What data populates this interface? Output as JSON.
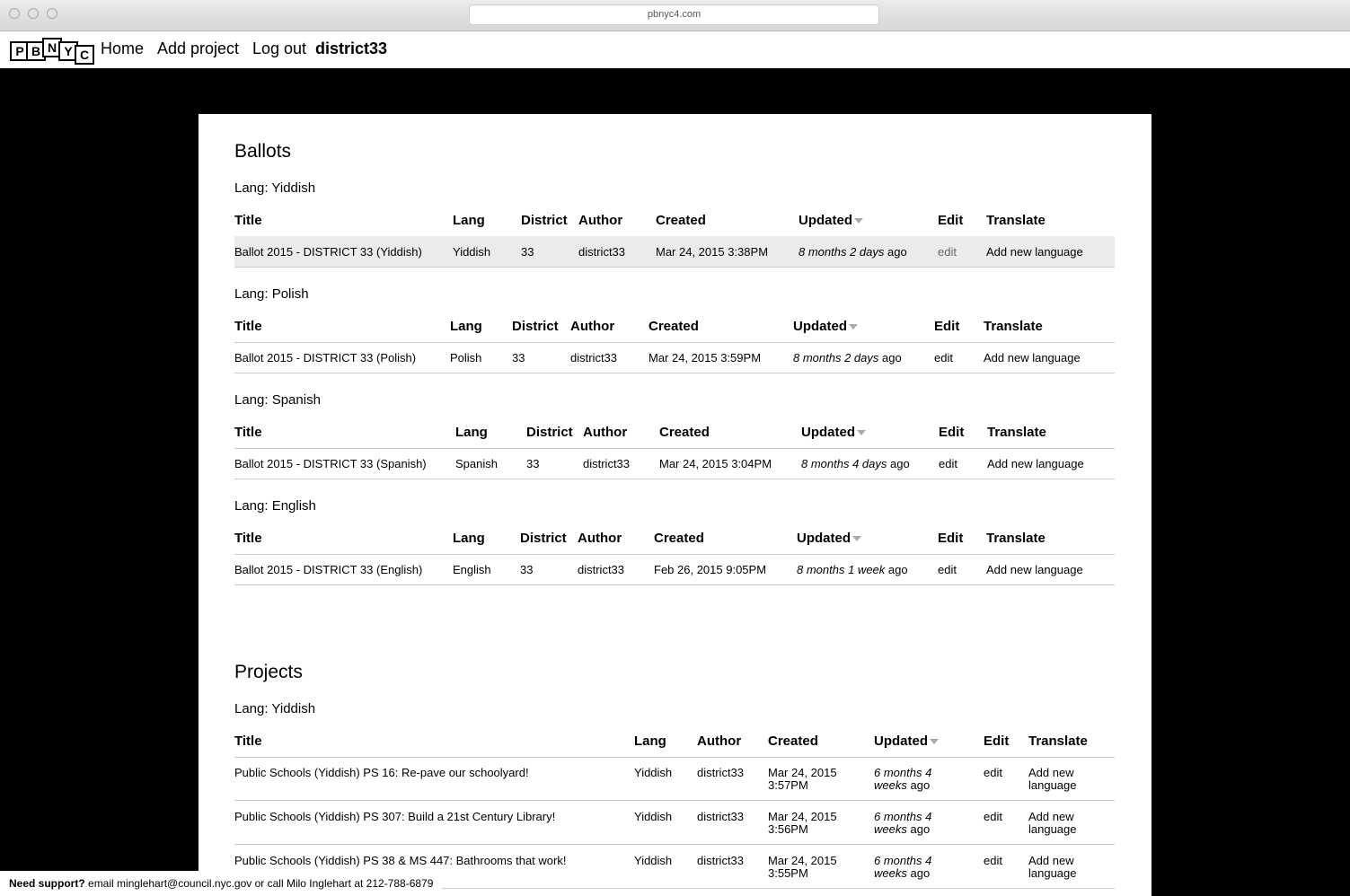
{
  "browser": {
    "url": "pbnyc4.com"
  },
  "nav": {
    "logo_letters": [
      "P",
      "B",
      "N",
      "Y",
      "C"
    ],
    "home": "Home",
    "add_project": "Add project",
    "logout": "Log out",
    "user": "district33"
  },
  "ballots": {
    "heading": "Ballots",
    "columns": {
      "title": "Title",
      "lang": "Lang",
      "district": "District",
      "author": "Author",
      "created": "Created",
      "updated": "Updated",
      "edit": "Edit",
      "translate": "Translate"
    },
    "groups": [
      {
        "lang_label": "Lang: Yiddish",
        "row": {
          "title": "Ballot 2015 - DISTRICT 33 (Yiddish)",
          "lang": "Yiddish",
          "district": "33",
          "author": "district33",
          "created": "Mar 24, 2015 3:38PM",
          "updated_italic": "8 months 2 days",
          "updated_suffix": "ago",
          "edit": "edit",
          "translate": "Add new language"
        }
      },
      {
        "lang_label": "Lang: Polish",
        "row": {
          "title": "Ballot 2015 - DISTRICT 33 (Polish)",
          "lang": "Polish",
          "district": "33",
          "author": "district33",
          "created": "Mar 24, 2015 3:59PM",
          "updated_italic": "8 months 2 days",
          "updated_suffix": "ago",
          "edit": "edit",
          "translate": "Add new language"
        }
      },
      {
        "lang_label": "Lang: Spanish",
        "row": {
          "title": "Ballot 2015 - DISTRICT 33 (Spanish)",
          "lang": "Spanish",
          "district": "33",
          "author": "district33",
          "created": "Mar 24, 2015 3:04PM",
          "updated_italic": "8 months 4 days",
          "updated_suffix": "ago",
          "edit": "edit",
          "translate": "Add new language"
        }
      },
      {
        "lang_label": "Lang: English",
        "row": {
          "title": "Ballot 2015 - DISTRICT 33 (English)",
          "lang": "English",
          "district": "33",
          "author": "district33",
          "created": "Feb 26, 2015 9:05PM",
          "updated_italic": "8 months 1 week",
          "updated_suffix": "ago",
          "edit": "edit",
          "translate": "Add new language"
        }
      }
    ]
  },
  "projects": {
    "heading": "Projects",
    "lang_label": "Lang: Yiddish",
    "columns": {
      "title": "Title",
      "lang": "Lang",
      "author": "Author",
      "created": "Created",
      "updated": "Updated",
      "edit": "Edit",
      "translate": "Translate"
    },
    "rows": [
      {
        "title": "Public Schools (Yiddish) PS 16: Re-pave our schoolyard!",
        "lang": "Yiddish",
        "author": "district33",
        "created_1": "Mar 24, 2015",
        "created_2": "3:57PM",
        "updated_1": "6 months 4",
        "updated_2_italic": "weeks",
        "updated_2_suffix": "ago",
        "edit": "edit",
        "translate_1": "Add new",
        "translate_2": "language"
      },
      {
        "title": "Public Schools (Yiddish) PS 307: Build a 21st Century Library!",
        "lang": "Yiddish",
        "author": "district33",
        "created_1": "Mar 24, 2015",
        "created_2": "3:56PM",
        "updated_1": "6 months 4",
        "updated_2_italic": "weeks",
        "updated_2_suffix": "ago",
        "edit": "edit",
        "translate_1": "Add new",
        "translate_2": "language"
      },
      {
        "title": "Public Schools (Yiddish) PS 38 & MS 447: Bathrooms that work!",
        "lang": "Yiddish",
        "author": "district33",
        "created_1": "Mar 24, 2015",
        "created_2": "3:55PM",
        "updated_1": "6 months 4",
        "updated_2_italic": "weeks",
        "updated_2_suffix": "ago",
        "edit": "edit",
        "translate_1": "Add new",
        "translate_2": "language"
      }
    ]
  },
  "footer": {
    "bold": "Need support?",
    "text": "email minglehart@council.nyc.gov or call Milo Inglehart at 212-788-6879"
  }
}
